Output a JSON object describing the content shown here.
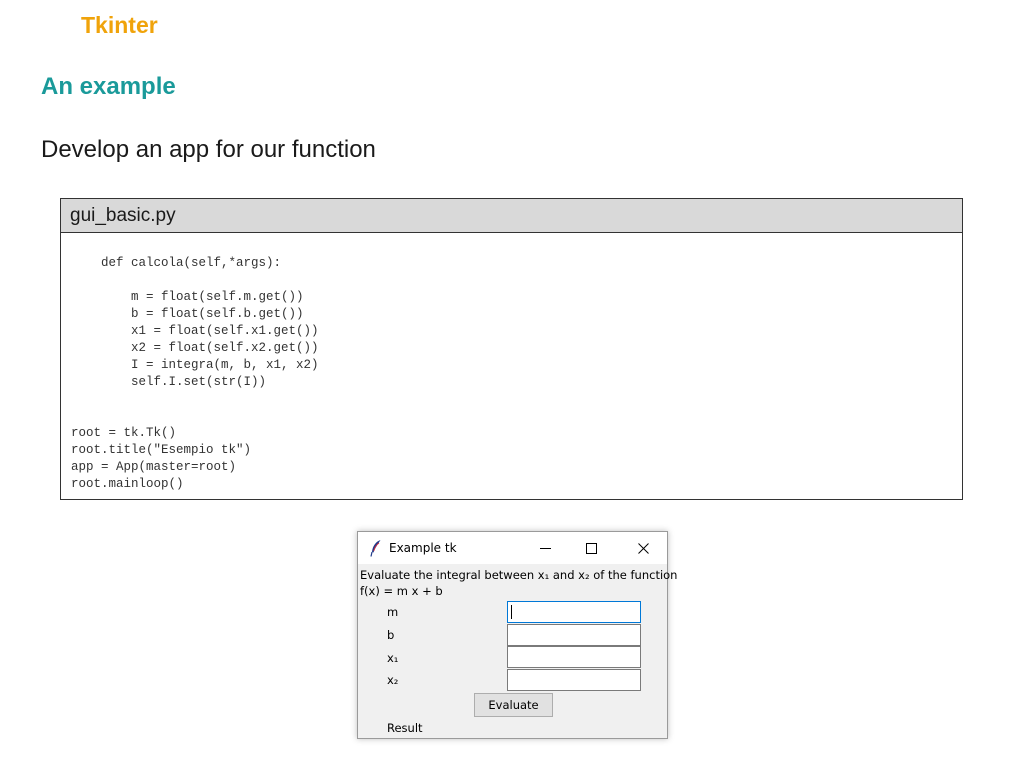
{
  "slide": {
    "header": "Tkinter",
    "title": "An example",
    "subtitle": "Develop an app for our function"
  },
  "code_box": {
    "filename": "gui_basic.py",
    "code": "    def calcola(self,*args):\n\n        m = float(self.m.get())\n        b = float(self.b.get())\n        x1 = float(self.x1.get())\n        x2 = float(self.x2.get())\n        I = integra(m, b, x1, x2)\n        self.I.set(str(I))\n\n\nroot = tk.Tk()\nroot.title(\"Esempio tk\")\napp = App(master=root)\nroot.mainloop()"
  },
  "tk_window": {
    "title": "Example tk",
    "window_icon": "tk-feather-icon",
    "description_line1": "Evaluate the integral between x₁ and x₂ of the function",
    "description_line2": "f(x) = m x + b",
    "fields": [
      {
        "label": "m",
        "value": ""
      },
      {
        "label": "b",
        "value": ""
      },
      {
        "label": "x₁",
        "value": ""
      },
      {
        "label": "x₂",
        "value": ""
      }
    ],
    "button_label": "Evaluate",
    "result_label": "Result"
  },
  "colors": {
    "header": "#f0a30a",
    "title": "#1a9a9a",
    "code_header_bg": "#d9d9d9",
    "focus_border": "#0078d7"
  }
}
